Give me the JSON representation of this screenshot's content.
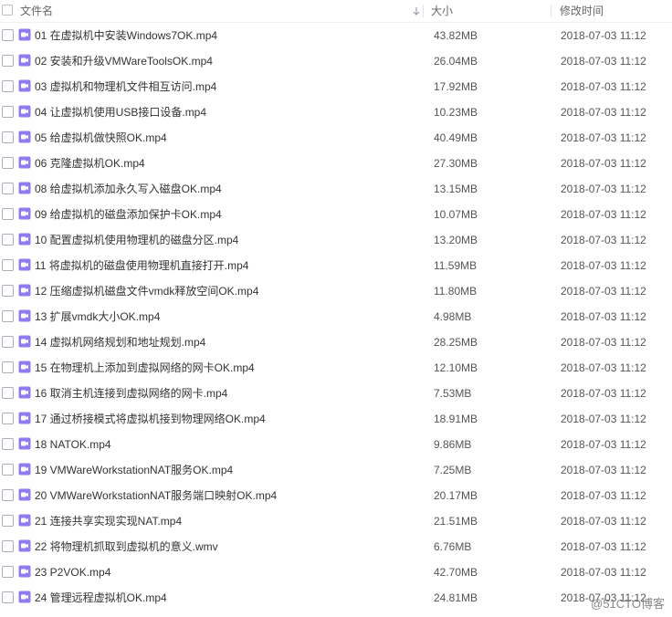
{
  "header": {
    "name_label": "文件名",
    "size_label": "大小",
    "date_label": "修改时间"
  },
  "colors": {
    "video_icon": "#8d7cf0",
    "header_text": "#666666",
    "row_text": "#333333"
  },
  "files": [
    {
      "name": "01 在虚拟机中安装Windows7OK.mp4",
      "size": "43.82MB",
      "date": "2018-07-03 11:12",
      "icon": "video-file-icon"
    },
    {
      "name": "02 安装和升级VMWareToolsOK.mp4",
      "size": "26.04MB",
      "date": "2018-07-03 11:12",
      "icon": "video-file-icon"
    },
    {
      "name": "03 虚拟机和物理机文件相互访问.mp4",
      "size": "17.92MB",
      "date": "2018-07-03 11:12",
      "icon": "video-file-icon"
    },
    {
      "name": "04 让虚拟机使用USB接口设备.mp4",
      "size": "10.23MB",
      "date": "2018-07-03 11:12",
      "icon": "video-file-icon"
    },
    {
      "name": "05 给虚拟机做快照OK.mp4",
      "size": "40.49MB",
      "date": "2018-07-03 11:12",
      "icon": "video-file-icon"
    },
    {
      "name": "06 克隆虚拟机OK.mp4",
      "size": "27.30MB",
      "date": "2018-07-03 11:12",
      "icon": "video-file-icon"
    },
    {
      "name": "08 给虚拟机添加永久写入磁盘OK.mp4",
      "size": "13.15MB",
      "date": "2018-07-03 11:12",
      "icon": "video-file-icon"
    },
    {
      "name": "09 给虚拟机的磁盘添加保护卡OK.mp4",
      "size": "10.07MB",
      "date": "2018-07-03 11:12",
      "icon": "video-file-icon"
    },
    {
      "name": "10 配置虚拟机使用物理机的磁盘分区.mp4",
      "size": "13.20MB",
      "date": "2018-07-03 11:12",
      "icon": "video-file-icon"
    },
    {
      "name": "11 将虚拟机的磁盘使用物理机直接打开.mp4",
      "size": "11.59MB",
      "date": "2018-07-03 11:12",
      "icon": "video-file-icon"
    },
    {
      "name": "12 压缩虚拟机磁盘文件vmdk释放空间OK.mp4",
      "size": "11.80MB",
      "date": "2018-07-03 11:12",
      "icon": "video-file-icon"
    },
    {
      "name": "13 扩展vmdk大小OK.mp4",
      "size": "4.98MB",
      "date": "2018-07-03 11:12",
      "icon": "video-file-icon"
    },
    {
      "name": "14 虚拟机网络规划和地址规划.mp4",
      "size": "28.25MB",
      "date": "2018-07-03 11:12",
      "icon": "video-file-icon"
    },
    {
      "name": "15 在物理机上添加到虚拟网络的网卡OK.mp4",
      "size": "12.10MB",
      "date": "2018-07-03 11:12",
      "icon": "video-file-icon"
    },
    {
      "name": "16 取消主机连接到虚拟网络的网卡.mp4",
      "size": "7.53MB",
      "date": "2018-07-03 11:12",
      "icon": "video-file-icon"
    },
    {
      "name": "17 通过桥接模式将虚拟机接到物理网络OK.mp4",
      "size": "18.91MB",
      "date": "2018-07-03 11:12",
      "icon": "video-file-icon"
    },
    {
      "name": "18 NATOK.mp4",
      "size": "9.86MB",
      "date": "2018-07-03 11:12",
      "icon": "video-file-icon"
    },
    {
      "name": "19 VMWareWorkstationNAT服务OK.mp4",
      "size": "7.25MB",
      "date": "2018-07-03 11:12",
      "icon": "video-file-icon"
    },
    {
      "name": "20 VMWareWorkstationNAT服务端口映射OK.mp4",
      "size": "20.17MB",
      "date": "2018-07-03 11:12",
      "icon": "video-file-icon"
    },
    {
      "name": "21 连接共享实现实现NAT.mp4",
      "size": "21.51MB",
      "date": "2018-07-03 11:12",
      "icon": "video-file-icon"
    },
    {
      "name": "22 将物理机抓取到虚拟机的意义.wmv",
      "size": "6.76MB",
      "date": "2018-07-03 11:12",
      "icon": "video-file-icon"
    },
    {
      "name": "23 P2VOK.mp4",
      "size": "42.70MB",
      "date": "2018-07-03 11:12",
      "icon": "video-file-icon"
    },
    {
      "name": "24 管理远程虚拟机OK.mp4",
      "size": "24.81MB",
      "date": "2018-07-03 11:12",
      "icon": "video-file-icon"
    }
  ],
  "watermark": "@51CTO博客"
}
